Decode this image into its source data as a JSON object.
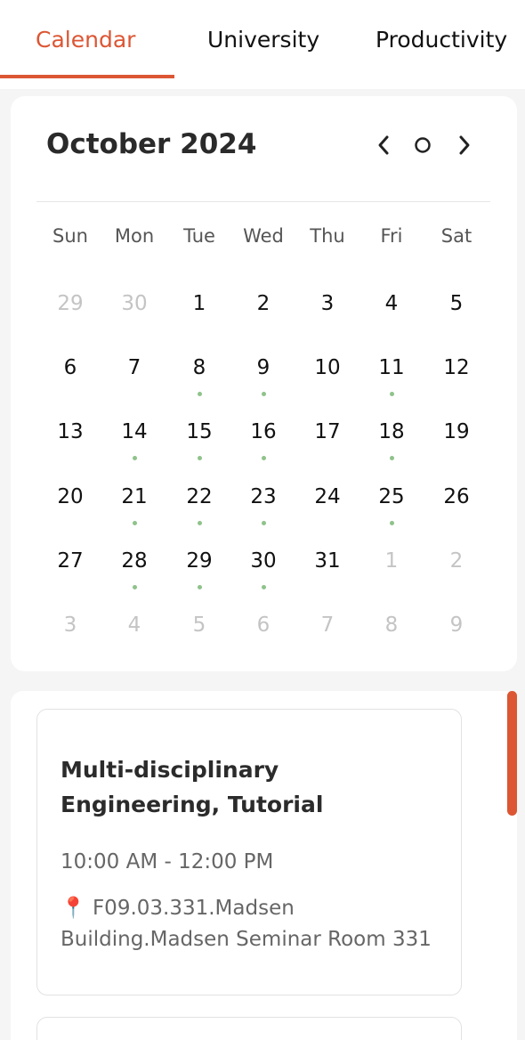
{
  "tabs": [
    {
      "label": "Calendar",
      "active": true
    },
    {
      "label": "University",
      "active": false
    },
    {
      "label": "Productivity",
      "active": false
    }
  ],
  "calendar": {
    "month_title": "October 2024",
    "weekdays": [
      "Sun",
      "Mon",
      "Tue",
      "Wed",
      "Thu",
      "Fri",
      "Sat"
    ],
    "weeks": [
      [
        {
          "d": "29",
          "m": true
        },
        {
          "d": "30",
          "m": true
        },
        {
          "d": "1"
        },
        {
          "d": "2"
        },
        {
          "d": "3"
        },
        {
          "d": "4"
        },
        {
          "d": "5"
        }
      ],
      [
        {
          "d": "6"
        },
        {
          "d": "7"
        },
        {
          "d": "8",
          "e": true
        },
        {
          "d": "9",
          "e": true
        },
        {
          "d": "10"
        },
        {
          "d": "11",
          "e": true
        },
        {
          "d": "12"
        }
      ],
      [
        {
          "d": "13"
        },
        {
          "d": "14",
          "e": true
        },
        {
          "d": "15",
          "e": true
        },
        {
          "d": "16",
          "e": true
        },
        {
          "d": "17"
        },
        {
          "d": "18",
          "e": true
        },
        {
          "d": "19"
        }
      ],
      [
        {
          "d": "20"
        },
        {
          "d": "21",
          "e": true
        },
        {
          "d": "22",
          "e": true
        },
        {
          "d": "23",
          "e": true
        },
        {
          "d": "24"
        },
        {
          "d": "25",
          "e": true
        },
        {
          "d": "26"
        }
      ],
      [
        {
          "d": "27"
        },
        {
          "d": "28",
          "e": true
        },
        {
          "d": "29",
          "e": true
        },
        {
          "d": "30",
          "e": true
        },
        {
          "d": "31"
        },
        {
          "d": "1",
          "m": true
        },
        {
          "d": "2",
          "m": true
        }
      ],
      [
        {
          "d": "3",
          "m": true
        },
        {
          "d": "4",
          "m": true
        },
        {
          "d": "5",
          "m": true
        },
        {
          "d": "6",
          "m": true
        },
        {
          "d": "7",
          "m": true
        },
        {
          "d": "8",
          "m": true
        },
        {
          "d": "9",
          "m": true
        }
      ]
    ],
    "icons": {
      "prev": "chevron-left-icon",
      "today": "circle-icon",
      "next": "chevron-right-icon"
    }
  },
  "events": [
    {
      "title": "Multi-disciplinary Engineering, Tutorial",
      "time": "10:00 AM - 12:00 PM",
      "location_icon": "📍",
      "location": "F09.03.331.Madsen Building.Madsen Seminar Room 331"
    },
    {
      "title": "",
      "time": "",
      "location_icon": "",
      "location": ""
    }
  ],
  "colors": {
    "accent": "#dc5634",
    "event_dot": "#8ec38a",
    "muted_day": "#c4c4c4"
  }
}
